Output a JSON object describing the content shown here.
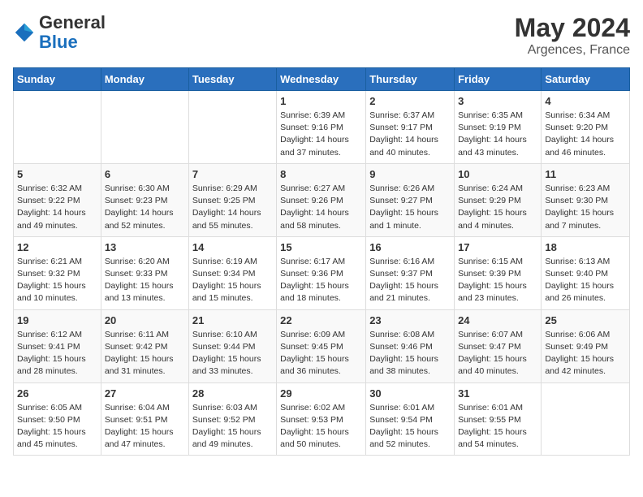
{
  "header": {
    "logo": {
      "general": "General",
      "blue": "Blue"
    },
    "title": "May 2024",
    "location": "Argences, France"
  },
  "days_of_week": [
    "Sunday",
    "Monday",
    "Tuesday",
    "Wednesday",
    "Thursday",
    "Friday",
    "Saturday"
  ],
  "weeks": [
    [
      {
        "day": "",
        "info": ""
      },
      {
        "day": "",
        "info": ""
      },
      {
        "day": "",
        "info": ""
      },
      {
        "day": "1",
        "info": "Sunrise: 6:39 AM\nSunset: 9:16 PM\nDaylight: 14 hours\nand 37 minutes."
      },
      {
        "day": "2",
        "info": "Sunrise: 6:37 AM\nSunset: 9:17 PM\nDaylight: 14 hours\nand 40 minutes."
      },
      {
        "day": "3",
        "info": "Sunrise: 6:35 AM\nSunset: 9:19 PM\nDaylight: 14 hours\nand 43 minutes."
      },
      {
        "day": "4",
        "info": "Sunrise: 6:34 AM\nSunset: 9:20 PM\nDaylight: 14 hours\nand 46 minutes."
      }
    ],
    [
      {
        "day": "5",
        "info": "Sunrise: 6:32 AM\nSunset: 9:22 PM\nDaylight: 14 hours\nand 49 minutes."
      },
      {
        "day": "6",
        "info": "Sunrise: 6:30 AM\nSunset: 9:23 PM\nDaylight: 14 hours\nand 52 minutes."
      },
      {
        "day": "7",
        "info": "Sunrise: 6:29 AM\nSunset: 9:25 PM\nDaylight: 14 hours\nand 55 minutes."
      },
      {
        "day": "8",
        "info": "Sunrise: 6:27 AM\nSunset: 9:26 PM\nDaylight: 14 hours\nand 58 minutes."
      },
      {
        "day": "9",
        "info": "Sunrise: 6:26 AM\nSunset: 9:27 PM\nDaylight: 15 hours\nand 1 minute."
      },
      {
        "day": "10",
        "info": "Sunrise: 6:24 AM\nSunset: 9:29 PM\nDaylight: 15 hours\nand 4 minutes."
      },
      {
        "day": "11",
        "info": "Sunrise: 6:23 AM\nSunset: 9:30 PM\nDaylight: 15 hours\nand 7 minutes."
      }
    ],
    [
      {
        "day": "12",
        "info": "Sunrise: 6:21 AM\nSunset: 9:32 PM\nDaylight: 15 hours\nand 10 minutes."
      },
      {
        "day": "13",
        "info": "Sunrise: 6:20 AM\nSunset: 9:33 PM\nDaylight: 15 hours\nand 13 minutes."
      },
      {
        "day": "14",
        "info": "Sunrise: 6:19 AM\nSunset: 9:34 PM\nDaylight: 15 hours\nand 15 minutes."
      },
      {
        "day": "15",
        "info": "Sunrise: 6:17 AM\nSunset: 9:36 PM\nDaylight: 15 hours\nand 18 minutes."
      },
      {
        "day": "16",
        "info": "Sunrise: 6:16 AM\nSunset: 9:37 PM\nDaylight: 15 hours\nand 21 minutes."
      },
      {
        "day": "17",
        "info": "Sunrise: 6:15 AM\nSunset: 9:39 PM\nDaylight: 15 hours\nand 23 minutes."
      },
      {
        "day": "18",
        "info": "Sunrise: 6:13 AM\nSunset: 9:40 PM\nDaylight: 15 hours\nand 26 minutes."
      }
    ],
    [
      {
        "day": "19",
        "info": "Sunrise: 6:12 AM\nSunset: 9:41 PM\nDaylight: 15 hours\nand 28 minutes."
      },
      {
        "day": "20",
        "info": "Sunrise: 6:11 AM\nSunset: 9:42 PM\nDaylight: 15 hours\nand 31 minutes."
      },
      {
        "day": "21",
        "info": "Sunrise: 6:10 AM\nSunset: 9:44 PM\nDaylight: 15 hours\nand 33 minutes."
      },
      {
        "day": "22",
        "info": "Sunrise: 6:09 AM\nSunset: 9:45 PM\nDaylight: 15 hours\nand 36 minutes."
      },
      {
        "day": "23",
        "info": "Sunrise: 6:08 AM\nSunset: 9:46 PM\nDaylight: 15 hours\nand 38 minutes."
      },
      {
        "day": "24",
        "info": "Sunrise: 6:07 AM\nSunset: 9:47 PM\nDaylight: 15 hours\nand 40 minutes."
      },
      {
        "day": "25",
        "info": "Sunrise: 6:06 AM\nSunset: 9:49 PM\nDaylight: 15 hours\nand 42 minutes."
      }
    ],
    [
      {
        "day": "26",
        "info": "Sunrise: 6:05 AM\nSunset: 9:50 PM\nDaylight: 15 hours\nand 45 minutes."
      },
      {
        "day": "27",
        "info": "Sunrise: 6:04 AM\nSunset: 9:51 PM\nDaylight: 15 hours\nand 47 minutes."
      },
      {
        "day": "28",
        "info": "Sunrise: 6:03 AM\nSunset: 9:52 PM\nDaylight: 15 hours\nand 49 minutes."
      },
      {
        "day": "29",
        "info": "Sunrise: 6:02 AM\nSunset: 9:53 PM\nDaylight: 15 hours\nand 50 minutes."
      },
      {
        "day": "30",
        "info": "Sunrise: 6:01 AM\nSunset: 9:54 PM\nDaylight: 15 hours\nand 52 minutes."
      },
      {
        "day": "31",
        "info": "Sunrise: 6:01 AM\nSunset: 9:55 PM\nDaylight: 15 hours\nand 54 minutes."
      },
      {
        "day": "",
        "info": ""
      }
    ]
  ]
}
